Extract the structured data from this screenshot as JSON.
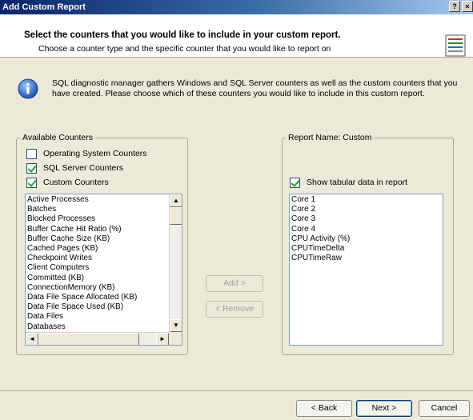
{
  "window": {
    "title": "Add Custom Report",
    "help_button": "?",
    "close_button": "×"
  },
  "header": {
    "title": "Select the counters that you would like to include in your custom report.",
    "subtitle": "Choose a counter type and the specific counter that you would like to report on"
  },
  "info": {
    "text": "SQL diagnostic manager gathers Windows and SQL Server counters as well as the custom counters that you have created.  Please choose which of these counters you would like to include in this custom report."
  },
  "available": {
    "legend": "Available Counters",
    "checkboxes": [
      {
        "label": "Operating System Counters",
        "checked": false
      },
      {
        "label": "SQL Server Counters",
        "checked": true
      },
      {
        "label": "Custom Counters",
        "checked": true
      }
    ],
    "items": [
      "Active Processes",
      "Batches",
      "Blocked Processes",
      "Buffer Cache Hit Ratio (%)",
      "Buffer Cache Size (KB)",
      "Cached Pages (KB)",
      "Checkpoint Writes",
      "Client Computers",
      "Committed (KB)",
      "ConnectionMemory (KB)",
      "Data File Space Allocated (KB)",
      "Data File Space Used (KB)",
      "Data Files",
      "Databases"
    ]
  },
  "report": {
    "legend": "Report Name: Custom",
    "show_tabular": {
      "label": "Show tabular data in report",
      "checked": true
    },
    "items": [
      "Core 1",
      "Core 2",
      "Core 3",
      "Core 4",
      "CPU Activity (%)",
      "CPUTimeDelta",
      "CPUTimeRaw"
    ]
  },
  "actions": {
    "add": "Add >",
    "remove": "< Remove"
  },
  "footer": {
    "back": "< Back",
    "next": "Next >",
    "cancel": "Cancel"
  },
  "colors": {
    "title_bar": "#0a246a",
    "dialog_bg": "#ece9d8",
    "check_mark": "#21a121"
  }
}
